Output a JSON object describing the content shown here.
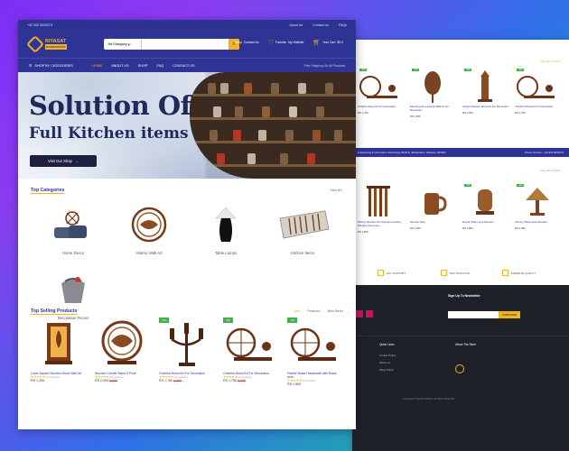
{
  "topbar": {
    "phone": "+92 000 0000073",
    "links": [
      "About Us",
      "Contact Us",
      "FAQs"
    ]
  },
  "header": {
    "logo_main": "RIYASAT",
    "logo_sub": "HANDICRAFTS",
    "search_category": "All Category",
    "search_placeholder": "I'm Shopping for...",
    "shop_label": "Shop",
    "shop_sub": "Contact Us",
    "wishlist_label": "Favorite",
    "wishlist_sub": "My Wishlist",
    "cart_label": "Your Cart",
    "cart_sub": "$0.0"
  },
  "nav": {
    "shop_by": "SHOP BY CATEGORIES",
    "items": [
      "HOME",
      "ABOUT US",
      "SHOP",
      "FAQ",
      "CONTACT US"
    ],
    "active": "HOME",
    "shipping": "Free Shipping On All Products"
  },
  "hero": {
    "title": "Solution Of",
    "subtitle": "Full Kitchen items",
    "cta": "Visit Our Shop"
  },
  "categories": {
    "title": "Top Categories",
    "view_all": "View All",
    "items": [
      "Home Decor",
      "Islamic Wall Art",
      "Table Lamps",
      "Kitchen Items",
      "Decoration Pieces"
    ]
  },
  "selling": {
    "title": "Top Selling Products",
    "tabs": [
      "New",
      "Featured",
      "Best Seller"
    ],
    "active_tab": "New",
    "products": [
      {
        "name": "Lotus Square Wooden Wood Wall Art",
        "reviews": "(0 reviews)",
        "price": "RS 1,250",
        "old": "",
        "badge": ""
      },
      {
        "name": "Wooden Candle Stand 3 Point",
        "reviews": "(0 reviews)",
        "price": "RS 2,500",
        "old": "4,000",
        "badge": ""
      },
      {
        "name": "Charkha Wood Art For Decoration",
        "reviews": "(0 reviews)",
        "price": "RS 1,750",
        "old": "4,000",
        "badge": "-5%"
      },
      {
        "name": "Charkha Wood Art For Decoration",
        "reviews": "(0 reviews)",
        "price": "RS 1,750",
        "old": "6,000",
        "badge": "-8%"
      },
      {
        "name": "Double Brass Handmade with Brass work",
        "reviews": "(0 reviews)",
        "price": "RS 1,950",
        "old": "",
        "badge": "-4%"
      }
    ]
  },
  "back": {
    "view_all": "View All Products",
    "row1": [
      {
        "name": "Charkha Wood Art For Decoration",
        "price": "RS 1,750",
        "badge": "-5%"
      },
      {
        "name": "Eternal grace peacock Wall Art For Decoration",
        "price": "RS 1,550",
        "badge": "-7%"
      },
      {
        "name": "African Wooden Wood Art For Decoration",
        "price": "RS 1,550",
        "badge": "-6%"
      },
      {
        "name": "Charkha Wood Art For Decoration",
        "price": "RS 1,750",
        "badge": "-8%"
      }
    ],
    "address": "Engineering & Information Technology (BUEIT), Bahawalpur, Pakistan, 063300",
    "phone": "Phone Number : +92 300 0000073",
    "row2": [
      {
        "name": "Kitchen Wooden Set Wooden Cooking Wooden Serve Item",
        "price": "RS 1,800",
        "badge": ""
      },
      {
        "name": "Wooden Mug",
        "price": "RS 1,050",
        "badge": ""
      },
      {
        "name": "Round Table Lamp Wooden",
        "price": "RS 1,850",
        "badge": "-5%"
      },
      {
        "name": "Carving Table Lamp Wooden",
        "price": "RS 2,990",
        "badge": "-5%"
      }
    ],
    "features": [
      "24/7 SUPPORT",
      "GET DISCOUNT",
      "PREMIUM QUALITY"
    ],
    "newsletter": "Sign Up To Newsletter",
    "subscribe": "SUBSCRIBE",
    "quick_links": "Quick Links",
    "about": "About The Store",
    "links": [
      "Cookie Policy",
      "About Us",
      "Shop Policy"
    ],
    "copyright": "Copyright © Riyasat Crafters. All Rights Reserved"
  }
}
